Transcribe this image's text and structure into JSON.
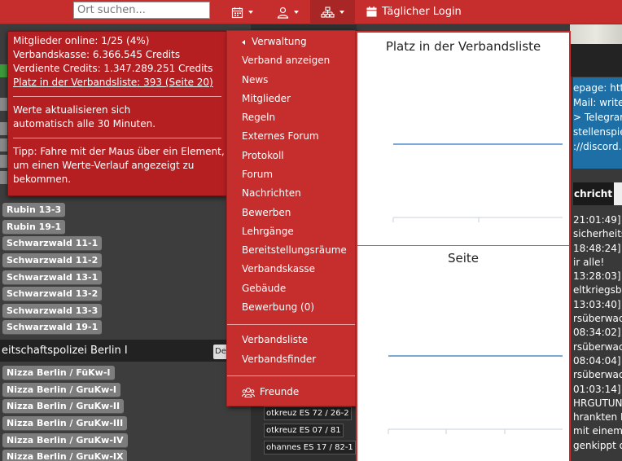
{
  "navbar": {
    "search_placeholder": "Ort suchen...",
    "daily_login_label": "Täglicher Login",
    "colors": {
      "bar": "#c62d2d",
      "active": "#a82626"
    }
  },
  "stats": {
    "members_online": "Mitglieder online: 1/25 (4%)",
    "treasury": "Verbandskasse: 6.366.545 Credits",
    "earned_credits": "Verdiente Credits: 1.347.289.251 Credits",
    "rank_link": "Platz in der Verbandsliste: 393 (Seite 20)",
    "auto_update_line1": "Werte aktualisieren sich",
    "auto_update_line2": "automatisch alle 30 Minuten.",
    "tip_line1": "Tipp: Fahre mit der Maus über ein Element,",
    "tip_line2": "um einen Werte-Verlauf angezeigt zu",
    "tip_line3": "bekommen."
  },
  "menu": {
    "back_label": "Verwaltung",
    "items": [
      "Verband anzeigen",
      "News",
      "Mitglieder",
      "Regeln",
      "Externes Forum",
      "Protokoll",
      "Forum",
      "Nachrichten",
      "Bewerben",
      "Lehrgänge",
      "Bereitstellungsräume",
      "Verbandskasse",
      "Gebäude",
      "Bewerbung (0)"
    ],
    "items2": [
      "Verbandsliste",
      "Verbandsfinder"
    ],
    "friends_label": "Freunde"
  },
  "charts": {
    "rank_title": "Platz in der Verbandsliste",
    "page_title": "Seite"
  },
  "chart_data": [
    {
      "type": "line",
      "title": "Platz in der Verbandsliste",
      "series": [
        {
          "values": [
            393,
            393
          ]
        }
      ]
    },
    {
      "type": "line",
      "title": "Seite",
      "series": [
        {
          "values": [
            20,
            20
          ]
        }
      ]
    }
  ],
  "left": {
    "vehicles": [
      "Rubin 13-3",
      "Rubin 19-1",
      "Schwarzwald 11-1",
      "Schwarzwald 11-2",
      "Schwarzwald 13-1",
      "Schwarzwald 13-2",
      "Schwarzwald 13-3",
      "Schwarzwald 19-1"
    ],
    "section_title": "eitschaftspolizei Berlin I",
    "section_btn": "De",
    "vehicles2": [
      "Nizza Berlin / FüKw-I",
      "Nizza Berlin / GruKw-I",
      "Nizza Berlin / GruKw-II",
      "Nizza Berlin / GruKw-III",
      "Nizza Berlin / GruKw-IV",
      "Nizza Berlin / GruKw-IX"
    ]
  },
  "middle": {
    "vehicles": [
      "otkreuz ES 72 / 26-2",
      "otkreuz ES 07 / 81",
      "ohannes ES 17 / 82-1"
    ]
  },
  "right": {
    "info": [
      "epage: http",
      "Mail: write",
      "> Telegram",
      "stellenspie",
      "://discord."
    ],
    "tab": "chricht",
    "messages": [
      "21:01:49]",
      "sicherheits",
      "18:48:24]",
      "ir alle!",
      "13:28:03]",
      "eltkriegsbo",
      "13:03:40]",
      "rsüberwac",
      "08:34:02]",
      "rsüberwac",
      "08:04:04]",
      "rsüberwac",
      "01:03:14]",
      "HRGUTUN",
      "hrankten E",
      " mit einem",
      "genkippt o"
    ]
  }
}
